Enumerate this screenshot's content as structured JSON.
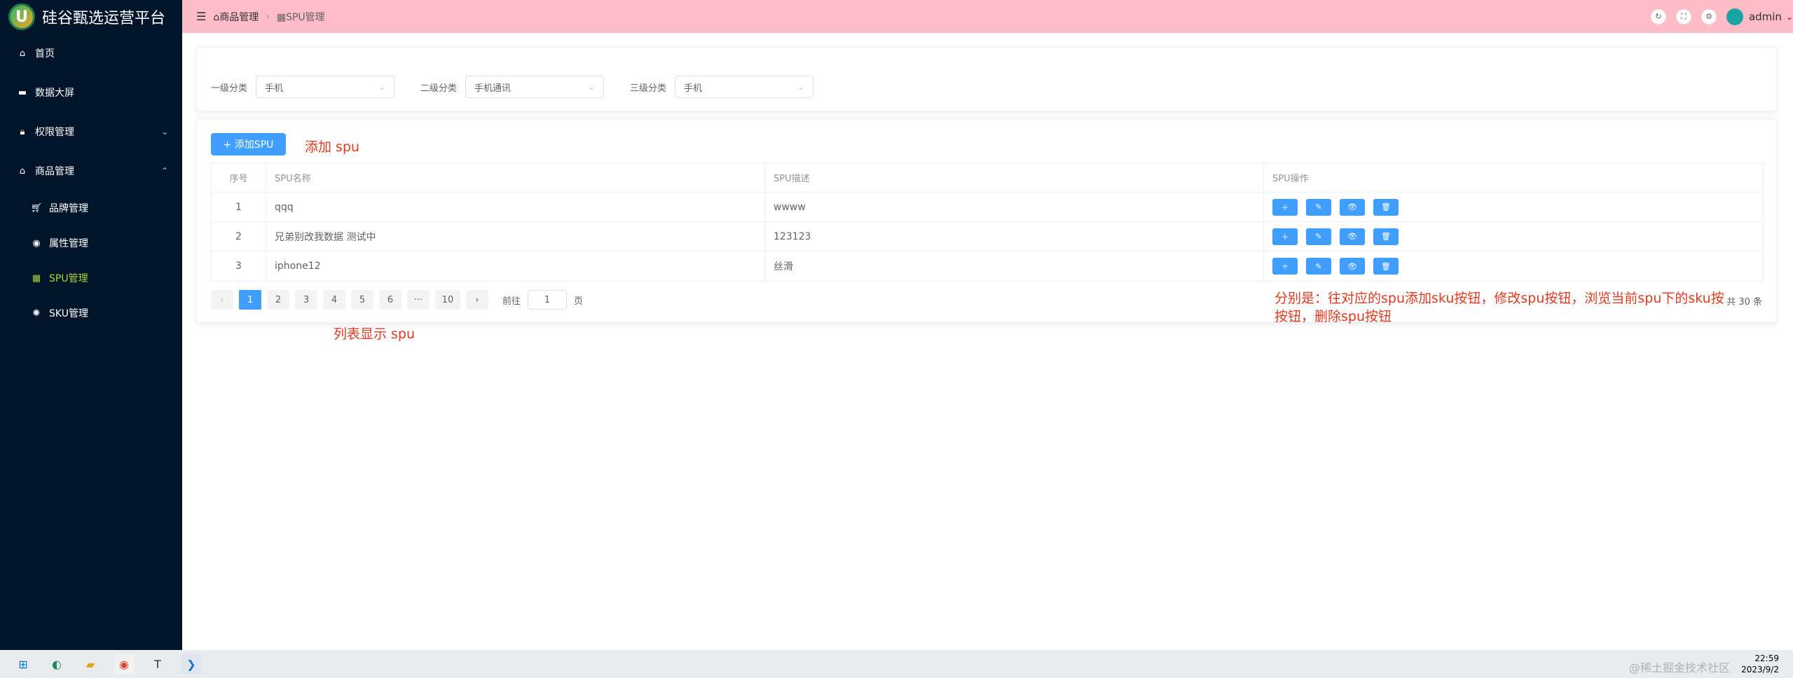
{
  "app": {
    "title": "硅谷甄选运营平台",
    "logo_letter": "U"
  },
  "sidebar": {
    "items": [
      {
        "label": "首页",
        "icon": "home-icon"
      },
      {
        "label": "数据大屏",
        "icon": "monitor-icon"
      },
      {
        "label": "权限管理",
        "icon": "lock-icon"
      },
      {
        "label": "商品管理",
        "icon": "goods-icon"
      }
    ],
    "sub": [
      {
        "label": "品牌管理",
        "icon": "cart-icon"
      },
      {
        "label": "属性管理",
        "icon": "chrome-icon"
      },
      {
        "label": "SPU管理",
        "icon": "calendar-icon"
      },
      {
        "label": "SKU管理",
        "icon": "orange-icon"
      }
    ]
  },
  "header": {
    "breadcrumb": [
      "商品管理",
      "SPU管理"
    ],
    "username": "admin"
  },
  "filters": [
    {
      "label": "一级分类",
      "value": "手机"
    },
    {
      "label": "二级分类",
      "value": "手机通讯"
    },
    {
      "label": "三级分类",
      "value": "手机"
    }
  ],
  "add_button": "+ 添加SPU",
  "table": {
    "headers": [
      "序号",
      "SPU名称",
      "SPU描述",
      "SPU操作"
    ],
    "rows": [
      {
        "idx": "1",
        "name": "qqq",
        "desc": "wwww"
      },
      {
        "idx": "2",
        "name": "兄弟别改我数据 测试中",
        "desc": "123123"
      },
      {
        "idx": "3",
        "name": "iphone12",
        "desc": "丝滑"
      }
    ]
  },
  "pagination": {
    "pages": [
      "1",
      "2",
      "3",
      "4",
      "5",
      "6",
      "···",
      "10"
    ],
    "current": "1",
    "goto_prefix": "前往",
    "goto_value": "1",
    "goto_suffix": "页",
    "total": "共 30 条"
  },
  "annotations": {
    "add": "添加  spu",
    "list": "列表显示 spu",
    "ops_line1": "分别是：往对应的spu添加sku按钮，修改spu按钮，浏览当前spu下的sku按",
    "ops_line2": "按钮，删除spu按钮"
  },
  "taskbar": {
    "time": "22:59",
    "date": "2023/9/2",
    "watermark": "@稀土掘金技术社区"
  }
}
